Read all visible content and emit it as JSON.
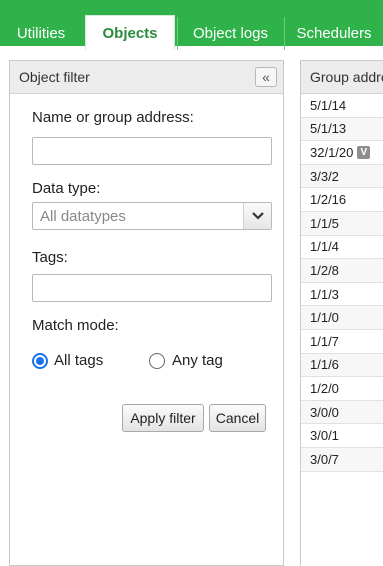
{
  "tabs": [
    {
      "label": "Utilities"
    },
    {
      "label": "Objects"
    },
    {
      "label": "Object logs"
    },
    {
      "label": "Schedulers"
    }
  ],
  "filter": {
    "title": "Object filter",
    "collapse_glyph": "«",
    "name_label": "Name or group address:",
    "name_value": "",
    "datatype_label": "Data type:",
    "datatype_value": "All datatypes",
    "tags_label": "Tags:",
    "tags_value": "",
    "match_label": "Match mode:",
    "match_all": "All tags",
    "match_any": "Any tag",
    "apply": "Apply filter",
    "cancel": "Cancel"
  },
  "table": {
    "header": "Group address",
    "rows": [
      {
        "addr": "5/1/14",
        "badge": ""
      },
      {
        "addr": "5/1/13",
        "badge": ""
      },
      {
        "addr": "32/1/20",
        "badge": "V"
      },
      {
        "addr": "3/3/2",
        "badge": ""
      },
      {
        "addr": "1/2/16",
        "badge": ""
      },
      {
        "addr": "1/1/5",
        "badge": ""
      },
      {
        "addr": "1/1/4",
        "badge": ""
      },
      {
        "addr": "1/2/8",
        "badge": ""
      },
      {
        "addr": "1/1/3",
        "badge": ""
      },
      {
        "addr": "1/1/0",
        "badge": ""
      },
      {
        "addr": "1/1/7",
        "badge": ""
      },
      {
        "addr": "1/1/6",
        "badge": ""
      },
      {
        "addr": "1/2/0",
        "badge": ""
      },
      {
        "addr": "3/0/0",
        "badge": ""
      },
      {
        "addr": "3/0/1",
        "badge": ""
      },
      {
        "addr": "3/0/7",
        "badge": ""
      }
    ]
  },
  "colors": {
    "brand_green": "#2fb24a",
    "active_tab_text": "#2a8c3c",
    "radio_blue": "#1a73e8"
  }
}
